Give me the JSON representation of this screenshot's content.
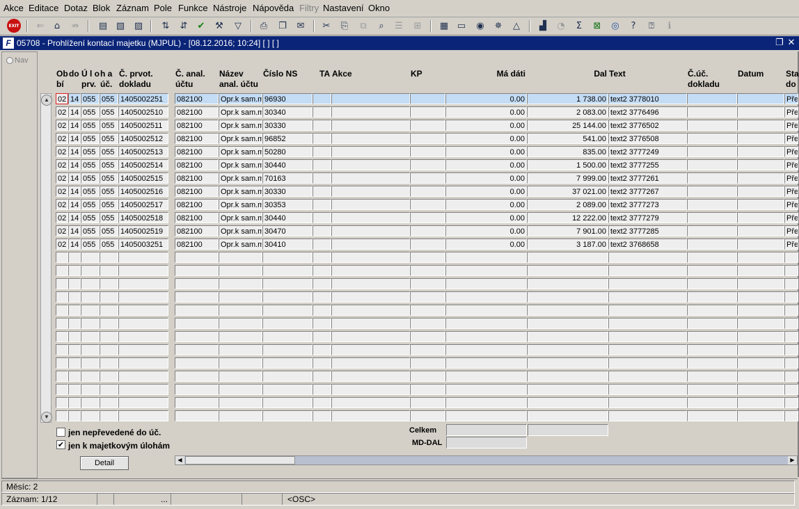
{
  "menu": [
    "Akce",
    "Editace",
    "Dotaz",
    "Blok",
    "Záznam",
    "Pole",
    "Funkce",
    "Nástroje",
    "Nápověda",
    "Filtry",
    "Nastavení",
    "Okno"
  ],
  "toolbar_exit": "EXIT",
  "window": {
    "title": "05708 - Prohlížení kontací majetku (MJPUL) - [08.12.2016; 10:24] [ ] [ ]",
    "logo": "F"
  },
  "nav_label": "Nav",
  "headers": {
    "obdobi": "Ob\nbí",
    "do": "do",
    "ulo": "Ú l o\nprv.",
    "ha": "h a\núč.",
    "cprvot": "Č. prvot.\ndokladu",
    "canal": "Č. anal.\núčtu",
    "nazev": "Název\nanal. účtu",
    "cislo_ns": "Číslo NS",
    "ta": "TA",
    "akce": "Akce",
    "kp": "KP",
    "madati": "Má dáti",
    "dal": "Dal",
    "text": "Text",
    "cuc": "Č.úč.\ndokladu",
    "datum": "Datum",
    "stav": "Sta\ndo"
  },
  "rows": [
    {
      "ob": "02",
      "do": "14",
      "ulo": "055",
      "ha": "055",
      "cprvot": "1405002251",
      "canal": "082100",
      "nazev": "Opr.k sam.m",
      "ns": "96930",
      "ta": "",
      "akce": "",
      "kp": "",
      "md": "0.00",
      "dal": "1 738.00",
      "text": "text2 3778010",
      "cuc": "",
      "datum": "",
      "stav": "Pře"
    },
    {
      "ob": "02",
      "do": "14",
      "ulo": "055",
      "ha": "055",
      "cprvot": "1405002510",
      "canal": "082100",
      "nazev": "Opr.k sam.m",
      "ns": "30340",
      "ta": "",
      "akce": "",
      "kp": "",
      "md": "0.00",
      "dal": "2 083.00",
      "text": "text2 3776496",
      "cuc": "",
      "datum": "",
      "stav": "Pře"
    },
    {
      "ob": "02",
      "do": "14",
      "ulo": "055",
      "ha": "055",
      "cprvot": "1405002511",
      "canal": "082100",
      "nazev": "Opr.k sam.m",
      "ns": "30330",
      "ta": "",
      "akce": "",
      "kp": "",
      "md": "0.00",
      "dal": "25 144.00",
      "text": "text2 3776502",
      "cuc": "",
      "datum": "",
      "stav": "Pře"
    },
    {
      "ob": "02",
      "do": "14",
      "ulo": "055",
      "ha": "055",
      "cprvot": "1405002512",
      "canal": "082100",
      "nazev": "Opr.k sam.m",
      "ns": "96852",
      "ta": "",
      "akce": "",
      "kp": "",
      "md": "0.00",
      "dal": "541.00",
      "text": "text2 3776508",
      "cuc": "",
      "datum": "",
      "stav": "Pře"
    },
    {
      "ob": "02",
      "do": "14",
      "ulo": "055",
      "ha": "055",
      "cprvot": "1405002513",
      "canal": "082100",
      "nazev": "Opr.k sam.m",
      "ns": "50280",
      "ta": "",
      "akce": "",
      "kp": "",
      "md": "0.00",
      "dal": "835.00",
      "text": "text2 3777249",
      "cuc": "",
      "datum": "",
      "stav": "Pře"
    },
    {
      "ob": "02",
      "do": "14",
      "ulo": "055",
      "ha": "055",
      "cprvot": "1405002514",
      "canal": "082100",
      "nazev": "Opr.k sam.m",
      "ns": "30440",
      "ta": "",
      "akce": "",
      "kp": "",
      "md": "0.00",
      "dal": "1 500.00",
      "text": "text2 3777255",
      "cuc": "",
      "datum": "",
      "stav": "Pře"
    },
    {
      "ob": "02",
      "do": "14",
      "ulo": "055",
      "ha": "055",
      "cprvot": "1405002515",
      "canal": "082100",
      "nazev": "Opr.k sam.m",
      "ns": "70163",
      "ta": "",
      "akce": "",
      "kp": "",
      "md": "0.00",
      "dal": "7 999.00",
      "text": "text2 3777261",
      "cuc": "",
      "datum": "",
      "stav": "Pře"
    },
    {
      "ob": "02",
      "do": "14",
      "ulo": "055",
      "ha": "055",
      "cprvot": "1405002516",
      "canal": "082100",
      "nazev": "Opr.k sam.m",
      "ns": "30330",
      "ta": "",
      "akce": "",
      "kp": "",
      "md": "0.00",
      "dal": "37 021.00",
      "text": "text2 3777267",
      "cuc": "",
      "datum": "",
      "stav": "Pře"
    },
    {
      "ob": "02",
      "do": "14",
      "ulo": "055",
      "ha": "055",
      "cprvot": "1405002517",
      "canal": "082100",
      "nazev": "Opr.k sam.m",
      "ns": "30353",
      "ta": "",
      "akce": "",
      "kp": "",
      "md": "0.00",
      "dal": "2 089.00",
      "text": "text2 3777273",
      "cuc": "",
      "datum": "",
      "stav": "Pře"
    },
    {
      "ob": "02",
      "do": "14",
      "ulo": "055",
      "ha": "055",
      "cprvot": "1405002518",
      "canal": "082100",
      "nazev": "Opr.k sam.m",
      "ns": "30440",
      "ta": "",
      "akce": "",
      "kp": "",
      "md": "0.00",
      "dal": "12 222.00",
      "text": "text2 3777279",
      "cuc": "",
      "datum": "",
      "stav": "Pře"
    },
    {
      "ob": "02",
      "do": "14",
      "ulo": "055",
      "ha": "055",
      "cprvot": "1405002519",
      "canal": "082100",
      "nazev": "Opr.k sam.m",
      "ns": "30470",
      "ta": "",
      "akce": "",
      "kp": "",
      "md": "0.00",
      "dal": "7 901.00",
      "text": "text2 3777285",
      "cuc": "",
      "datum": "",
      "stav": "Pře"
    },
    {
      "ob": "02",
      "do": "14",
      "ulo": "055",
      "ha": "055",
      "cprvot": "1405003251",
      "canal": "082100",
      "nazev": "Opr.k sam.m",
      "ns": "30410",
      "ta": "",
      "akce": "",
      "kp": "",
      "md": "0.00",
      "dal": "3 187.00",
      "text": "text2 3768658",
      "cuc": "",
      "datum": "",
      "stav": "Pře"
    }
  ],
  "filters": {
    "neprevedene_label": "jen nepřevedené do úč.",
    "neprevedene_checked": false,
    "majetkove_label": "jen k majetkovým úlohám",
    "majetkove_checked": true
  },
  "summary": {
    "celkem_label": "Celkem",
    "mddal_label": "MD-DAL"
  },
  "detail_button": "Detail",
  "status": {
    "mesic": "Měsíc: 2",
    "zaznam": "Záznam: 1/12",
    "dots": "...",
    "mode": "<OSC>"
  }
}
